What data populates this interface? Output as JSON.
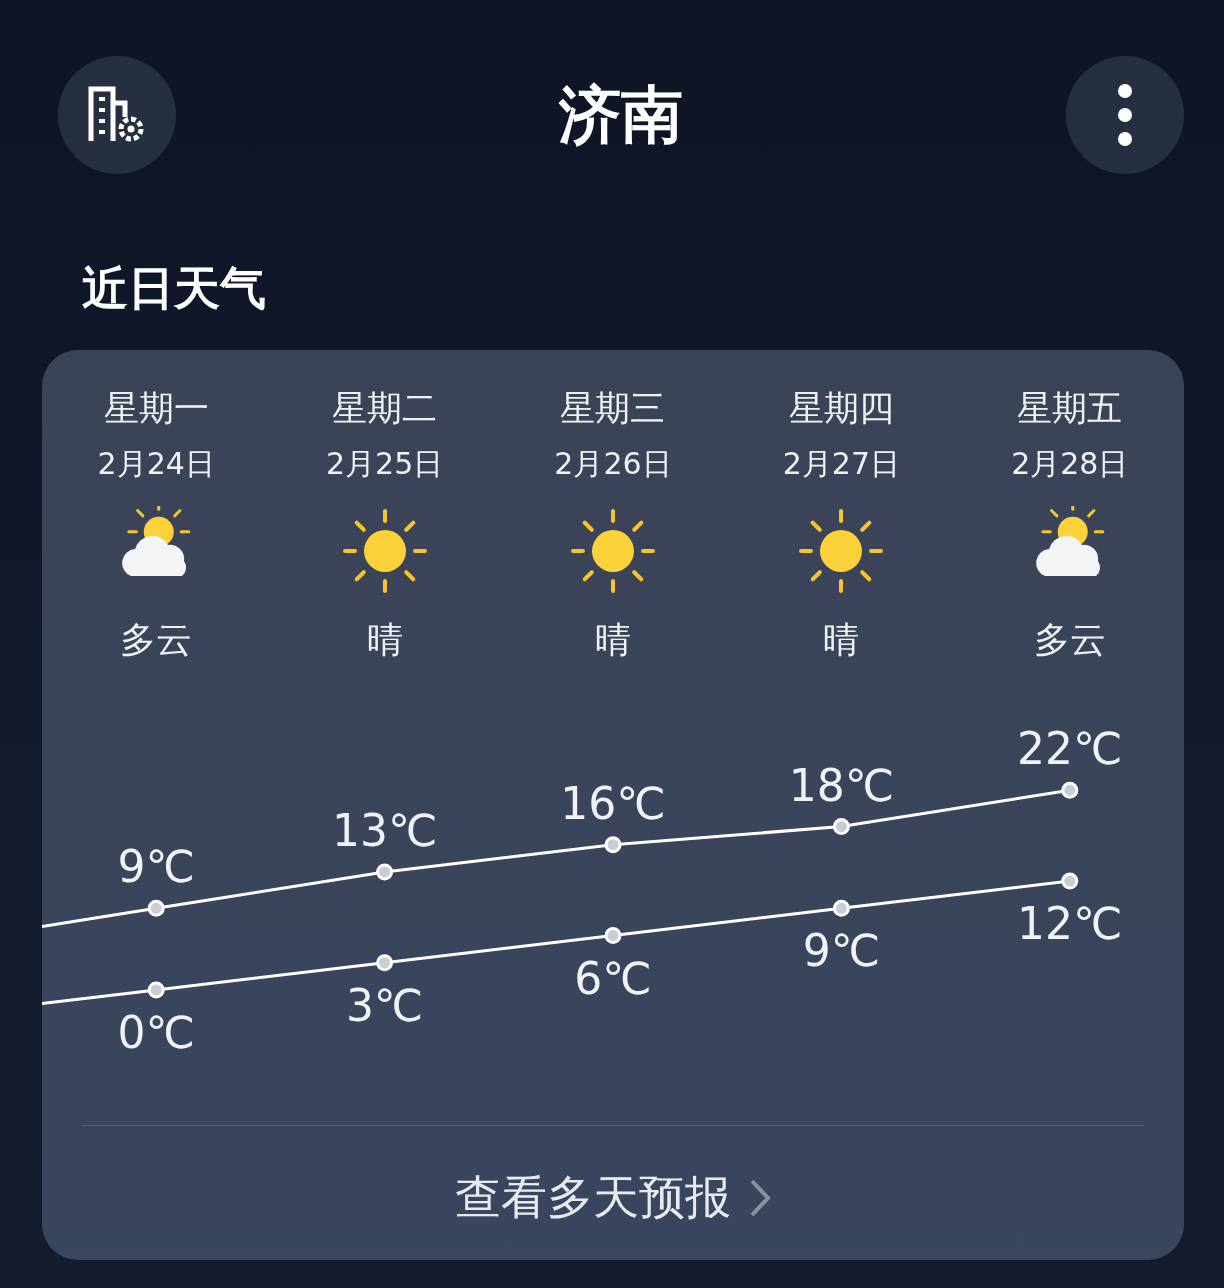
{
  "header": {
    "title": "济南"
  },
  "section": {
    "title": "近日天气"
  },
  "forecast": {
    "days": [
      {
        "weekday": "星期一",
        "date": "2月24日",
        "kind": "partly_cloudy",
        "condition": "多云",
        "high": "9℃",
        "low": "0℃"
      },
      {
        "weekday": "星期二",
        "date": "2月25日",
        "kind": "sunny",
        "condition": "晴",
        "high": "13℃",
        "low": "3℃"
      },
      {
        "weekday": "星期三",
        "date": "2月26日",
        "kind": "sunny",
        "condition": "晴",
        "high": "16℃",
        "low": "6℃"
      },
      {
        "weekday": "星期四",
        "date": "2月27日",
        "kind": "sunny",
        "condition": "晴",
        "high": "18℃",
        "low": "9℃"
      },
      {
        "weekday": "星期五",
        "date": "2月28日",
        "kind": "partly_cloudy",
        "condition": "多云",
        "high": "22℃",
        "low": "12℃"
      }
    ],
    "more_button": {
      "label": "查看多天预报"
    }
  }
}
